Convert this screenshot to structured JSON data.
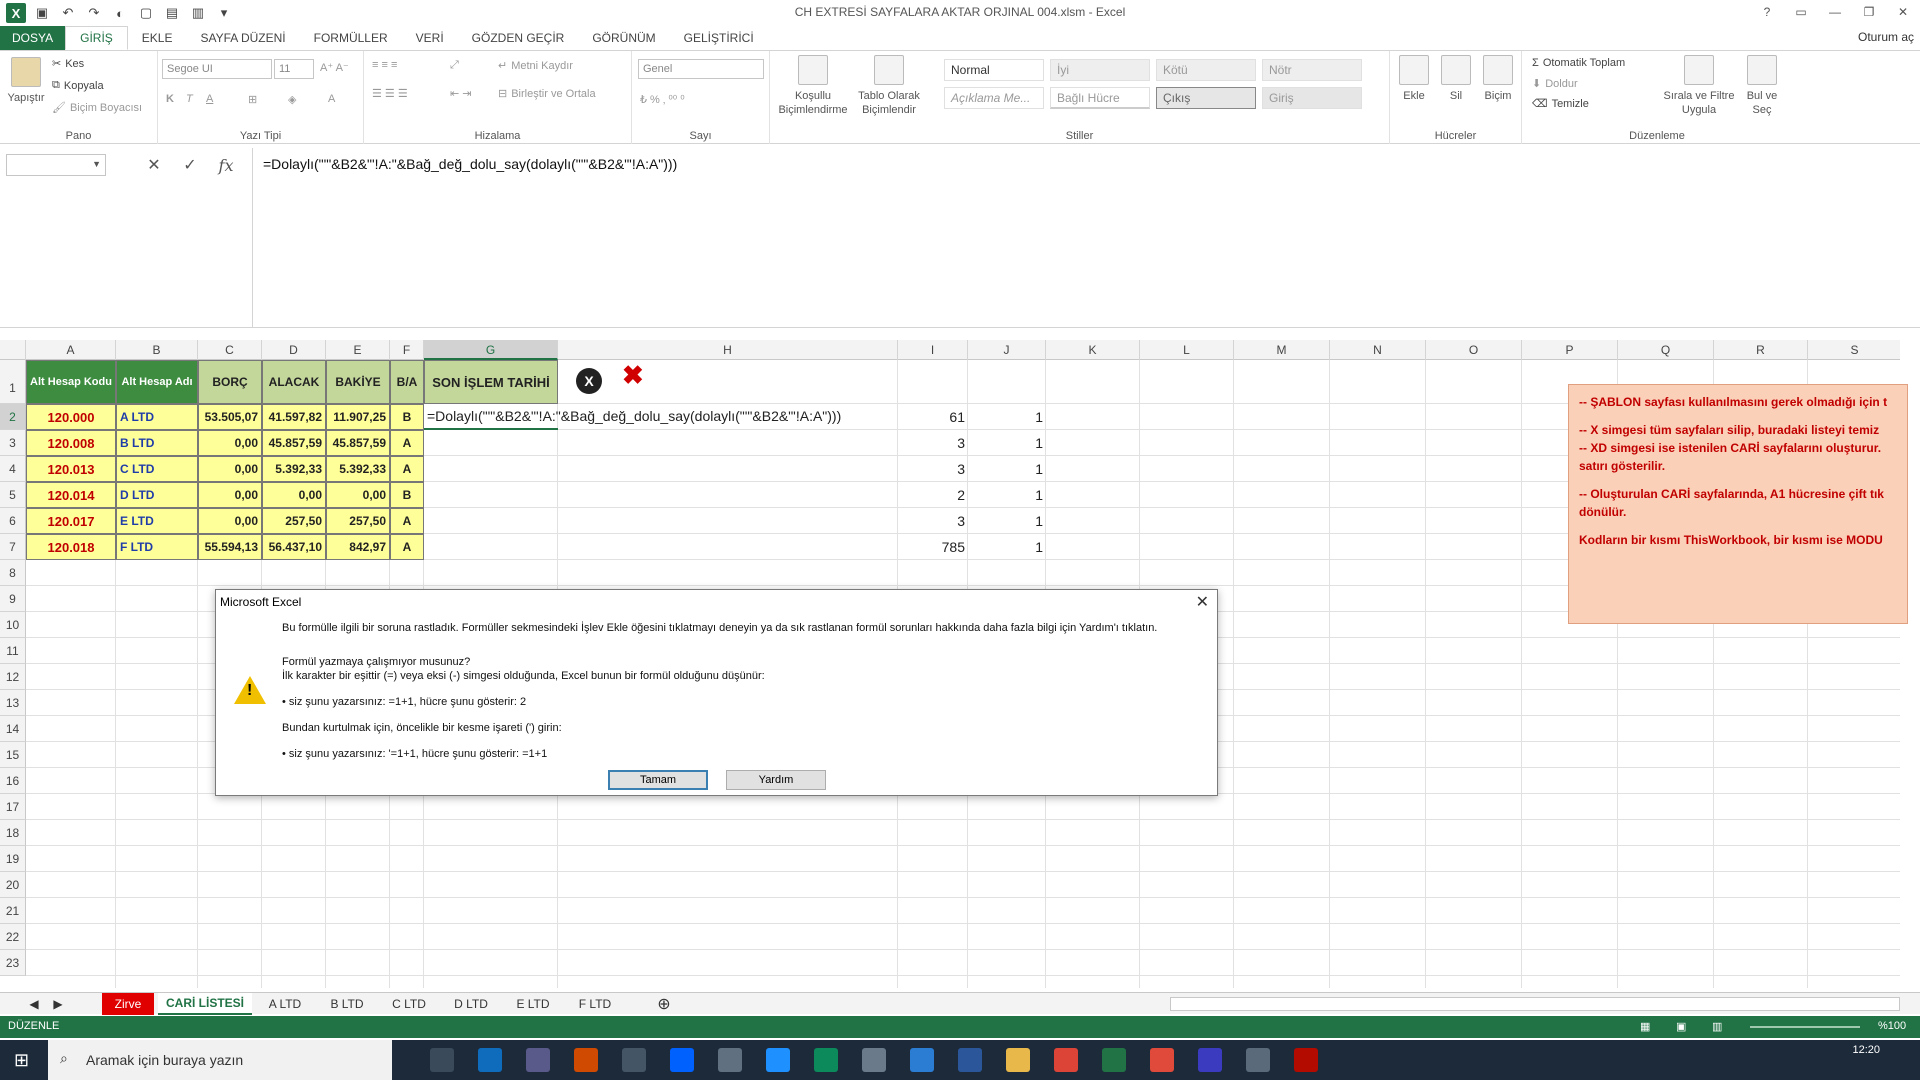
{
  "window": {
    "title": "CH EXTRESİ SAYFALARA AKTAR ORJINAL 004.xlsm - Excel",
    "signin": "Oturum aç"
  },
  "ribbon_tabs": [
    "DOSYA",
    "GİRİŞ",
    "EKLE",
    "SAYFA DÜZENİ",
    "FORMÜLLER",
    "VERİ",
    "GÖZDEN GEÇİR",
    "GÖRÜNÜM",
    "GELİŞTİRİCİ"
  ],
  "ribbon": {
    "pano": {
      "label": "Pano",
      "paste": "Yapıştır",
      "cut": "Kes",
      "copy": "Kopyala",
      "format_painter": "Biçim Boyacısı"
    },
    "font": {
      "label": "Yazı Tipi",
      "name": "Segoe UI",
      "size": "11"
    },
    "align": {
      "label": "Hizalama",
      "wrap": "Metni Kaydır",
      "merge": "Birleştir ve Ortala"
    },
    "number": {
      "label": "Sayı",
      "format": "Genel"
    },
    "styles": {
      "label": "Stiller",
      "conditional": "Koşullu Biçimlendirme",
      "table": "Tablo Olarak Biçimlendir",
      "cells": [
        "Normal",
        "İyi",
        "Kötü",
        "Nötr",
        "Açıklama Me...",
        "Bağlı Hücre",
        "Çıkış",
        "Giriş"
      ]
    },
    "cells": {
      "label": "Hücreler",
      "insert": "Ekle",
      "delete": "Sil",
      "format": "Biçim"
    },
    "editing": {
      "label": "Düzenleme",
      "autosum": "Otomatik Toplam",
      "fill": "Doldur",
      "clear": "Temizle",
      "sort": "Sırala ve Filtre Uygula",
      "find": "Bul ve Seç"
    }
  },
  "formula_bar": {
    "fx": "fx",
    "formula": "=Dolaylı(\"'\"&B2&\"'!A:\"&Bağ_değ_dolu_say(dolaylı(\"'\"&B2&\"'!A:A\")))"
  },
  "columns": [
    "A",
    "B",
    "C",
    "D",
    "E",
    "F",
    "G",
    "H",
    "I",
    "J",
    "K",
    "L",
    "M",
    "N",
    "O",
    "P",
    "Q",
    "R",
    "S"
  ],
  "rows": [
    "1",
    "2",
    "3",
    "4",
    "5",
    "6",
    "7",
    "8",
    "9",
    "10",
    "11",
    "12",
    "13",
    "14",
    "15",
    "16",
    "17",
    "18",
    "19",
    "20",
    "21",
    "22",
    "23"
  ],
  "table": {
    "headers": [
      "Alt Hesap Kodu",
      "Alt Hesap Adı",
      "BORÇ",
      "ALACAK",
      "BAKİYE",
      "B/A",
      "SON İŞLEM TARİHİ"
    ],
    "rows": [
      [
        "120.000",
        "A LTD",
        "53.505,07",
        "41.597,82",
        "11.907,25",
        "B"
      ],
      [
        "120.008",
        "B LTD",
        "0,00",
        "45.857,59",
        "45.857,59",
        "A"
      ],
      [
        "120.013",
        "C LTD",
        "0,00",
        "5.392,33",
        "5.392,33",
        "A"
      ],
      [
        "120.014",
        "D LTD",
        "0,00",
        "0,00",
        "0,00",
        "B"
      ],
      [
        "120.017",
        "E LTD",
        "0,00",
        "257,50",
        "257,50",
        "A"
      ],
      [
        "120.018",
        "F LTD",
        "55.594,13",
        "56.437,10",
        "842,97",
        "A"
      ]
    ],
    "editing_cell": "=Dolaylı(\"'\"&B2&\"'!A:\"&Bağ_değ_dolu_say(dolaylı(\"'\"&B2&\"'!A:A\")))",
    "col_i": [
      "61",
      "3",
      "3",
      "2",
      "3",
      "785"
    ],
    "col_j": [
      "1",
      "1",
      "1",
      "1",
      "1",
      "1"
    ]
  },
  "buttons": {
    "xd": "X",
    "x": "✖"
  },
  "note": [
    "-- ŞABLON sayfası kullanılmasını gerek olmadığı için t",
    "-- X  simgesi tüm sayfaları silip, buradaki listeyi temiz",
    "-- XD simgesi ise istenilen CARİ sayfalarını oluşturur.",
    "satırı gösterilir.",
    "-- Oluşturulan CARİ sayfalarında, A1 hücresine çift tık",
    "dönülür.",
    "Kodların bir kısmı ThisWorkbook, bir kısmı ise MODU"
  ],
  "dialog": {
    "title": "Microsoft Excel",
    "line1": "Bu formülle ilgili bir soruna rastladık. Formüller sekmesindeki İşlev Ekle öğesini tıklatmayı deneyin ya da sık rastlanan formül sorunları hakkında daha fazla bilgi için Yardım'ı tıklatın.",
    "line2": "Formül yazmaya çalışmıyor musunuz?",
    "line3": "İlk karakter bir eşittir (=) veya eksi (-) simgesi olduğunda, Excel bunun bir formül olduğunu düşünür:",
    "line4": "• siz şunu yazarsınız:   =1+1, hücre şunu gösterir:   2",
    "line5": "Bundan kurtulmak için, öncelikle bir kesme işareti (') girin:",
    "line6": "• siz şunu yazarsınız:   '=1+1, hücre şunu gösterir:   =1+1",
    "ok": "Tamam",
    "help": "Yardım"
  },
  "sheet_tabs": [
    "Zirve",
    "CARİ LİSTESİ",
    "A LTD",
    "B LTD",
    "C LTD",
    "D LTD",
    "E LTD",
    "F LTD"
  ],
  "status": {
    "mode": "DÜZENLE",
    "zoom": "%100"
  },
  "taskbar": {
    "search": "Aramak için buraya yazın",
    "time": "12:20"
  }
}
